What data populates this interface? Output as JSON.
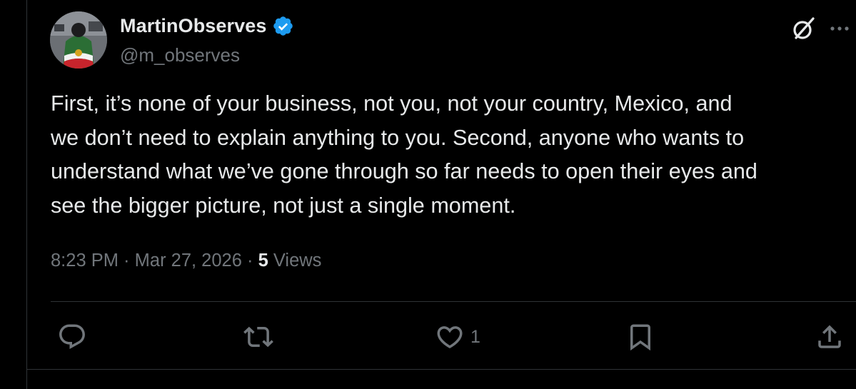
{
  "author": {
    "display_name": "MartinObserves",
    "handle": "@m_observes",
    "verified": true
  },
  "tweet": {
    "text": "First, it’s none of your business, not you, not your country, Mexico, and\nwe don’t need to explain anything to you. Second, anyone who wants to\nunderstand what we’ve gone through so far needs to open their eyes and\nsee the bigger picture, not just a single moment.",
    "time": "8:23 PM",
    "separator": " · ",
    "date": "Mar 27, 2026",
    "views_count": "5",
    "views_label": "Views"
  },
  "actions": {
    "reply_count": "",
    "repost_count": "",
    "like_count": "1",
    "bookmark_count": "",
    "share_count": ""
  },
  "icons": {
    "header": [
      "grok-icon",
      "more-icon"
    ],
    "actions": [
      "reply-icon",
      "repost-icon",
      "like-icon",
      "bookmark-icon",
      "share-icon"
    ]
  },
  "colors": {
    "background": "#000000",
    "text_primary": "#e7e9ea",
    "text_secondary": "#71767b",
    "verified_blue": "#1d9bf0",
    "divider": "#2f3336"
  }
}
